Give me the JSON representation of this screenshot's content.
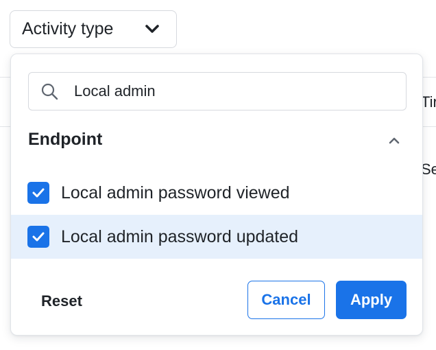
{
  "filter": {
    "trigger_label": "Activity type",
    "trigger_icon": "chevron-down-icon"
  },
  "background": {
    "fragment_1": "Tir",
    "fragment_2": "Se"
  },
  "dropdown": {
    "search": {
      "value": "Local admin",
      "icon": "search-icon"
    },
    "group": {
      "title": "Endpoint",
      "expanded": true,
      "icon": "chevron-up-icon"
    },
    "options": [
      {
        "label": "Local admin password viewed",
        "checked": true,
        "highlighted": false
      },
      {
        "label": "Local admin password updated",
        "checked": true,
        "highlighted": true
      }
    ],
    "actions": {
      "reset_label": "Reset",
      "cancel_label": "Cancel",
      "apply_label": "Apply"
    }
  },
  "colors": {
    "accent": "#1a73e8",
    "highlight_row": "#e6f0fc",
    "border": "#d6d9de",
    "text": "#1f2328"
  }
}
